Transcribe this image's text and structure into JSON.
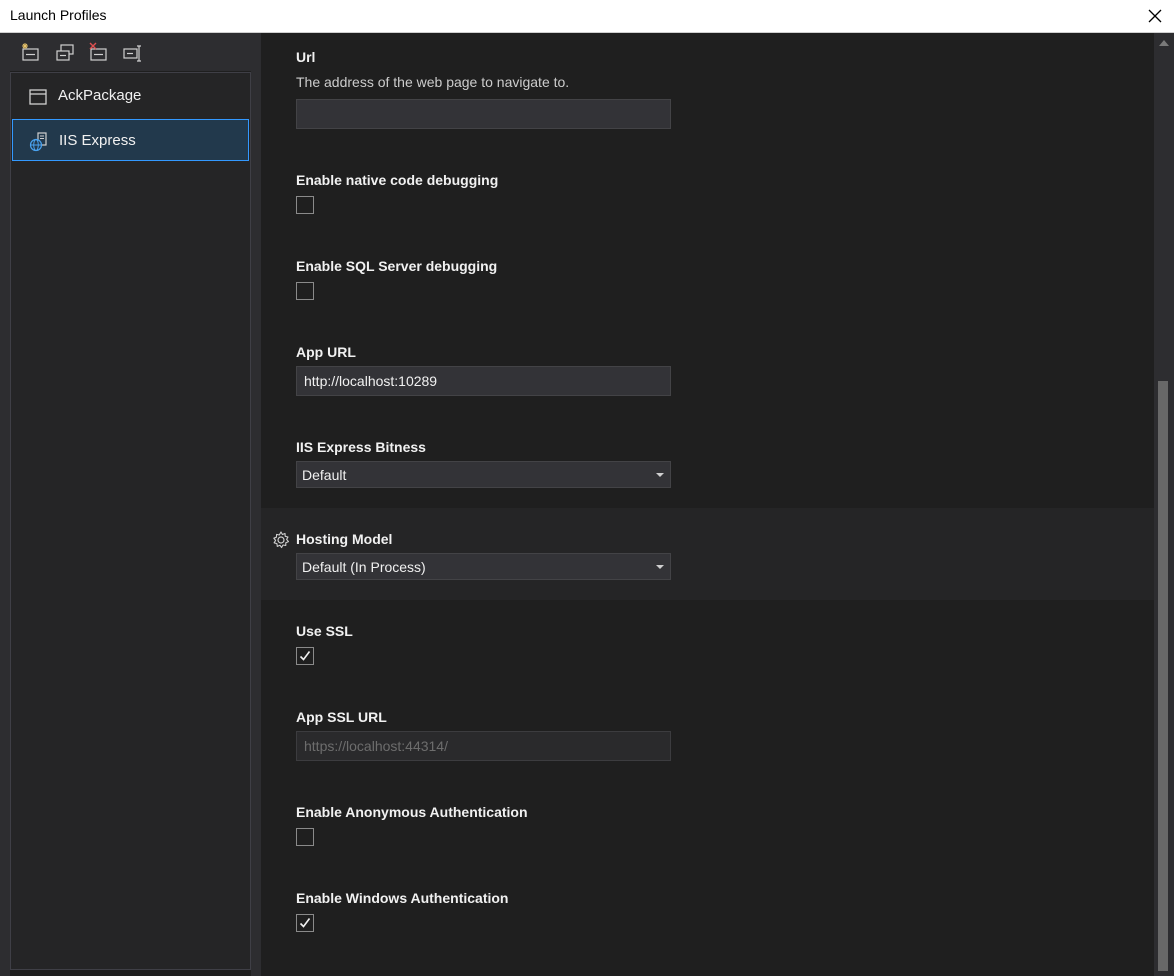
{
  "window": {
    "title": "Launch Profiles"
  },
  "toolbar": {
    "buttons": [
      {
        "icon": "new-profile-icon"
      },
      {
        "icon": "copy-profile-icon"
      },
      {
        "icon": "delete-profile-icon"
      },
      {
        "icon": "rename-profile-icon"
      }
    ]
  },
  "profiles": [
    {
      "label": "AckPackage",
      "icon": "window-icon",
      "selected": false
    },
    {
      "label": "IIS Express",
      "icon": "web-server-icon",
      "selected": true
    }
  ],
  "settings": {
    "url": {
      "label": "Url",
      "description": "The address of the web page to navigate to.",
      "value": ""
    },
    "native_debugging": {
      "label": "Enable native code debugging",
      "checked": false
    },
    "sql_debugging": {
      "label": "Enable SQL Server debugging",
      "checked": false
    },
    "app_url": {
      "label": "App URL",
      "value": "http://localhost:10289"
    },
    "bitness": {
      "label": "IIS Express Bitness",
      "value": "Default"
    },
    "hosting_model": {
      "label": "Hosting Model",
      "value": "Default (In Process)",
      "icon": "gear-icon"
    },
    "use_ssl": {
      "label": "Use SSL",
      "checked": true
    },
    "app_ssl_url": {
      "label": "App SSL URL",
      "value": "https://localhost:44314/"
    },
    "anonymous_auth": {
      "label": "Enable Anonymous Authentication",
      "checked": false
    },
    "windows_auth": {
      "label": "Enable Windows Authentication",
      "checked": true
    }
  },
  "colors": {
    "selection_bg": "#22394c",
    "selection_border": "#3399ff",
    "background": "#1f1f1f"
  }
}
